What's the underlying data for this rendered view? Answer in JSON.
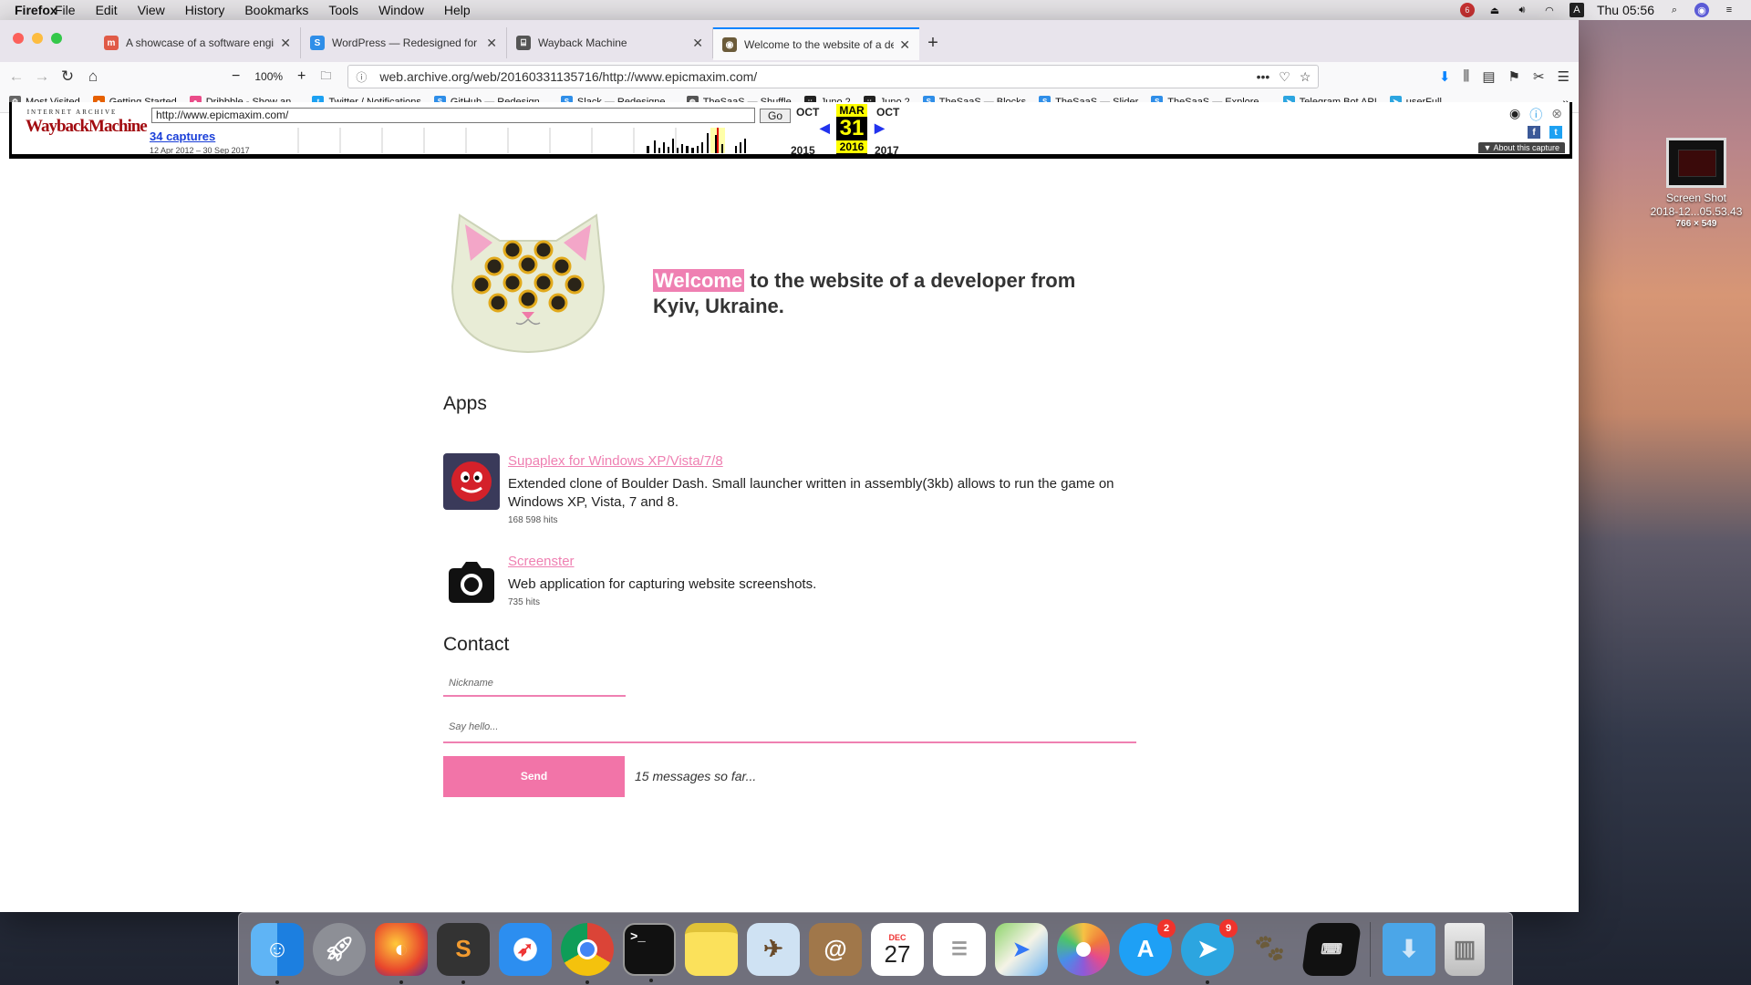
{
  "menubar": {
    "app_name": "Firefox",
    "items": [
      "File",
      "Edit",
      "View",
      "History",
      "Bookmarks",
      "Tools",
      "Window",
      "Help"
    ],
    "clock": "Thu 05:56",
    "notification_count": "6",
    "input_source": "A"
  },
  "tabs": [
    {
      "title": "A showcase of a software engin",
      "favicon": "m",
      "color": "#e05a47",
      "active": false
    },
    {
      "title": "WordPress — Redesigned for d",
      "favicon": "S",
      "color": "#2f8ee8",
      "active": false
    },
    {
      "title": "Wayback Machine",
      "favicon": "⌸",
      "color": "#555555",
      "active": false
    },
    {
      "title": "Welcome to the website of a de",
      "favicon": "◉",
      "color": "#6b5b3a",
      "active": true
    }
  ],
  "navbar": {
    "zoom": "100%",
    "url": "web.archive.org/web/20160331135716/http://www.epicmaxim.com/"
  },
  "bookmarks": [
    {
      "label": "Most Visited",
      "icon": "⚙",
      "color": "#666666"
    },
    {
      "label": "Getting Started",
      "icon": "●",
      "color": "#e66000"
    },
    {
      "label": "Dribbble - Show an...",
      "icon": "●",
      "color": "#ea4c89"
    },
    {
      "label": "Twitter / Notifications",
      "icon": "t",
      "color": "#1da1f2"
    },
    {
      "label": "GitHub — Redesign...",
      "icon": "S",
      "color": "#2f8ee8"
    },
    {
      "label": "Slack — Redesigne...",
      "icon": "S",
      "color": "#2f8ee8"
    },
    {
      "label": "TheSaaS — Shuffle",
      "icon": "◍",
      "color": "#555555"
    },
    {
      "label": "Juno 2",
      "icon": "::",
      "color": "#222222"
    },
    {
      "label": "Juno 2",
      "icon": "::",
      "color": "#222222"
    },
    {
      "label": "TheSaaS — Blocks",
      "icon": "S",
      "color": "#2f8ee8"
    },
    {
      "label": "TheSaaS — Slider",
      "icon": "S",
      "color": "#2f8ee8"
    },
    {
      "label": "TheSaaS — Explore ...",
      "icon": "S",
      "color": "#2f8ee8"
    },
    {
      "label": "Telegram Bot API",
      "icon": "➤",
      "color": "#2ca5e0"
    },
    {
      "label": "userFull",
      "icon": "➤",
      "color": "#2ca5e0"
    }
  ],
  "wayback": {
    "logo_top": "INTERNET ARCHIVE",
    "logo_main": "WaybackMachine",
    "url": "http://www.epicmaxim.com/",
    "go": "Go",
    "captures": "34 captures",
    "range": "12 Apr 2012 – 30 Sep 2017",
    "prev_month": "OCT",
    "prev_year": "2015",
    "cur_month": "MAR",
    "cur_day": "31",
    "cur_year": "2016",
    "next_month": "OCT",
    "next_year": "2017",
    "about": "▼ About this capture"
  },
  "page": {
    "welcome_highlight": "Welcome",
    "welcome_rest": " to the website of a developer from Kyiv, Ukraine.",
    "apps_heading": "Apps",
    "apps": [
      {
        "title": "Supaplex for Windows XP/Vista/7/8",
        "desc": "Extended clone of Boulder Dash. Small launcher written in assembly(3kb) allows to run the game on Windows XP, Vista, 7 and 8.",
        "hits": "168 598 hits"
      },
      {
        "title": "Screenster",
        "desc": "Web application for capturing website screenshots.",
        "hits": "735 hits"
      }
    ],
    "contact_heading": "Contact",
    "nickname_placeholder": "Nickname",
    "message_placeholder": "Say hello...",
    "send": "Send",
    "messages": "15 messages so far..."
  },
  "desktop": {
    "file_line1": "Screen Shot",
    "file_line2": "2018-12...05.53.43",
    "file_dim": "766 × 549"
  },
  "dock": {
    "calendar_month": "DEC",
    "calendar_day": "27",
    "appstore_badge": "2",
    "telegram_badge": "9"
  },
  "colors": {
    "accent": "#ef80b2",
    "send": "#f274a8",
    "wayback_red": "#a20b10"
  }
}
